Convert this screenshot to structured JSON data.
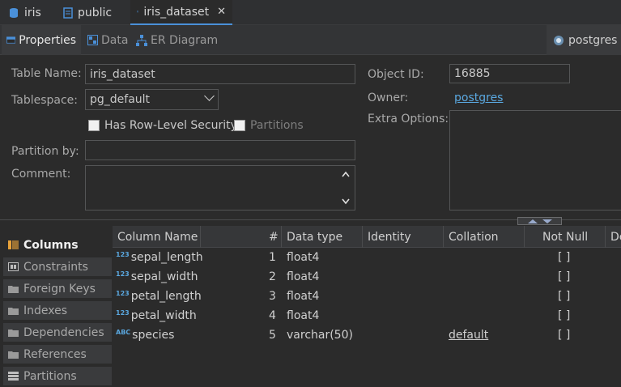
{
  "editor_tabs": [
    {
      "label": "iris",
      "icon": "database-icon"
    },
    {
      "label": "public",
      "icon": "schema-icon"
    },
    {
      "label": "iris_dataset",
      "icon": "table-icon",
      "active": true
    }
  ],
  "sub_tabs": {
    "properties": "Properties",
    "data": "Data",
    "er": "ER Diagram",
    "connection": "postgres"
  },
  "form": {
    "table_name_label": "Table Name:",
    "table_name": "iris_dataset",
    "tablespace_label": "Tablespace:",
    "tablespace": "pg_default",
    "rls_label": "Has Row-Level Security",
    "partitions_label": "Partitions",
    "partition_by_label": "Partition by:",
    "partition_by": "",
    "comment_label": "Comment:",
    "comment": "",
    "object_id_label": "Object ID:",
    "object_id": "16885",
    "owner_label": "Owner:",
    "owner": "postgres",
    "extra_options_label": "Extra Options:"
  },
  "side_tabs": [
    "Columns",
    "Constraints",
    "Foreign Keys",
    "Indexes",
    "Dependencies",
    "References",
    "Partitions"
  ],
  "table": {
    "headers": [
      "Column Name",
      "#",
      "Data type",
      "Identity",
      "Collation",
      "Not Null",
      "De"
    ],
    "rows": [
      {
        "type_icon": "123",
        "name": "sepal_length",
        "num": "1",
        "type": "float4",
        "identity": "",
        "collation": "",
        "not_null": "[ ]"
      },
      {
        "type_icon": "123",
        "name": "sepal_width",
        "num": "2",
        "type": "float4",
        "identity": "",
        "collation": "",
        "not_null": "[ ]"
      },
      {
        "type_icon": "123",
        "name": "petal_length",
        "num": "3",
        "type": "float4",
        "identity": "",
        "collation": "",
        "not_null": "[ ]"
      },
      {
        "type_icon": "123",
        "name": "petal_width",
        "num": "4",
        "type": "float4",
        "identity": "",
        "collation": "",
        "not_null": "[ ]"
      },
      {
        "type_icon": "ABC",
        "name": "species",
        "num": "5",
        "type": "varchar(50)",
        "identity": "",
        "collation": "default",
        "not_null": "[ ]"
      }
    ]
  },
  "colors": {
    "accent": "#4a90d9",
    "link": "#5aa8e0",
    "background": "#2b2b2b"
  }
}
